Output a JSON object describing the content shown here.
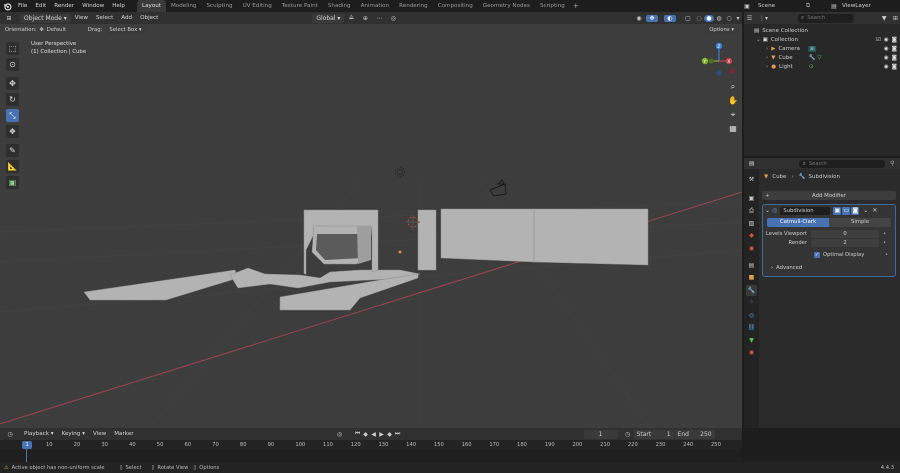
{
  "app": {
    "menu": [
      "File",
      "Edit",
      "Render",
      "Window",
      "Help"
    ],
    "workspaces": [
      "Layout",
      "Modeling",
      "Sculpting",
      "UV Editing",
      "Texture Paint",
      "Shading",
      "Animation",
      "Rendering",
      "Compositing",
      "Geometry Nodes",
      "Scripting"
    ],
    "active_workspace": "Layout",
    "scene": "Scene",
    "view_layer": "ViewLayer"
  },
  "viewport_header": {
    "mode": "Object Mode",
    "menus": [
      "View",
      "Select",
      "Add",
      "Object"
    ],
    "transform_orientation": "Global",
    "orientation_label": "Orientation:",
    "orientation_value": "Default",
    "drag_label": "Drag:",
    "drag_value": "Select Box",
    "options": "Options"
  },
  "viewport": {
    "title": "User Perspective",
    "subtitle": "(1) Collection | Cube",
    "gizmo_axes": [
      "X",
      "Y",
      "Z"
    ],
    "colors": {
      "bg": "#3d3d3d",
      "x_axis": "#c2414d",
      "y_axis": "#80b32b",
      "z_axis": "#3d7fd9",
      "mesh": "#b7b7b7"
    }
  },
  "outliner": {
    "search_placeholder": "Search",
    "root": "Scene Collection",
    "collection": "Collection",
    "items": [
      "Camera",
      "Cube",
      "Light"
    ]
  },
  "properties": {
    "search_placeholder": "Search",
    "breadcrumb_object": "Cube",
    "breadcrumb_modifier": "Subdivision",
    "add_modifier": "Add Modifier",
    "modifier_name": "Subdivision",
    "type_options": [
      "Catmull-Clark",
      "Simple"
    ],
    "selected_type": "Catmull-Clark",
    "levels_viewport_label": "Levels Viewport",
    "levels_viewport_value": "0",
    "render_label": "Render",
    "render_value": "2",
    "optimal_display": "Optimal Display",
    "advanced": "Advanced"
  },
  "timeline": {
    "menus": [
      "Playback",
      "Keying",
      "View",
      "Marker"
    ],
    "current_frame": "1",
    "start_label": "Start",
    "start": "1",
    "end_label": "End",
    "end": "250",
    "ticks": [
      "1",
      "10",
      "20",
      "30",
      "40",
      "50",
      "60",
      "70",
      "80",
      "90",
      "100",
      "110",
      "120",
      "130",
      "140",
      "150",
      "160",
      "170",
      "180",
      "190",
      "200",
      "210",
      "220",
      "230",
      "240",
      "250"
    ],
    "playhead": "1"
  },
  "statusbar": {
    "message": "Active object has non-uniform scale",
    "select": "Select",
    "rotate_view": "Rotate View",
    "options": "Options",
    "version": "4.4.3"
  }
}
